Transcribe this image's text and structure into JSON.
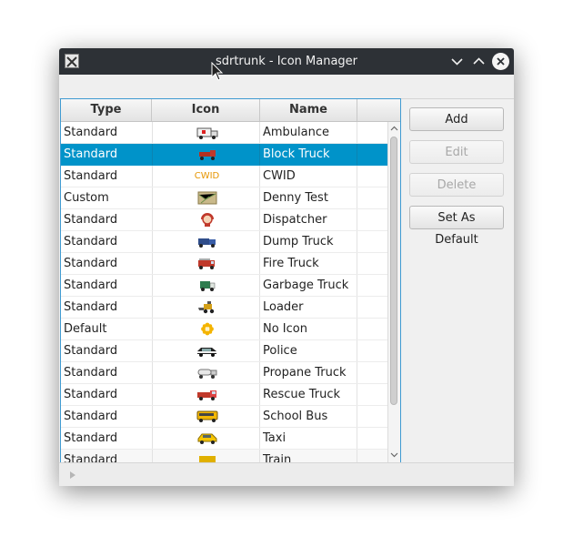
{
  "window": {
    "title": "sdrtrunk - Icon Manager",
    "app_icon": "x-app-icon",
    "controls": [
      "minimize-chevron-icon",
      "maximize-chevron-icon",
      "close-icon"
    ]
  },
  "table": {
    "columns": [
      "Type",
      "Icon",
      "Name",
      ""
    ],
    "rows": [
      {
        "type": "Standard",
        "icon": "ambulance-icon",
        "name": "Ambulance"
      },
      {
        "type": "Standard",
        "icon": "block-truck-icon",
        "name": "Block Truck",
        "selected": true
      },
      {
        "type": "Standard",
        "icon": "cwid-icon",
        "icon_text": "CWID",
        "name": "CWID"
      },
      {
        "type": "Custom",
        "icon": "map-icon",
        "name": "Denny Test"
      },
      {
        "type": "Standard",
        "icon": "dispatcher-icon",
        "name": "Dispatcher"
      },
      {
        "type": "Standard",
        "icon": "dump-truck-icon",
        "name": "Dump Truck"
      },
      {
        "type": "Standard",
        "icon": "fire-truck-icon",
        "name": "Fire Truck"
      },
      {
        "type": "Standard",
        "icon": "garbage-truck-icon",
        "name": "Garbage Truck"
      },
      {
        "type": "Standard",
        "icon": "loader-icon",
        "name": "Loader"
      },
      {
        "type": "Default",
        "icon": "no-icon-flower-icon",
        "name": "No Icon"
      },
      {
        "type": "Standard",
        "icon": "police-car-icon",
        "name": "Police"
      },
      {
        "type": "Standard",
        "icon": "propane-truck-icon",
        "name": "Propane Truck"
      },
      {
        "type": "Standard",
        "icon": "rescue-truck-icon",
        "name": "Rescue Truck"
      },
      {
        "type": "Standard",
        "icon": "school-bus-icon",
        "name": "School Bus"
      },
      {
        "type": "Standard",
        "icon": "taxi-icon",
        "name": "Taxi"
      },
      {
        "type": "Standard",
        "icon": "train-icon",
        "name": "Train"
      }
    ]
  },
  "buttons": {
    "add": "Add",
    "edit": "Edit",
    "delete": "Delete",
    "set_default": "Set As Default"
  },
  "colors": {
    "selection": "#0093c9",
    "table_border": "#3f9ad1",
    "titlebar": "#2d3136"
  }
}
